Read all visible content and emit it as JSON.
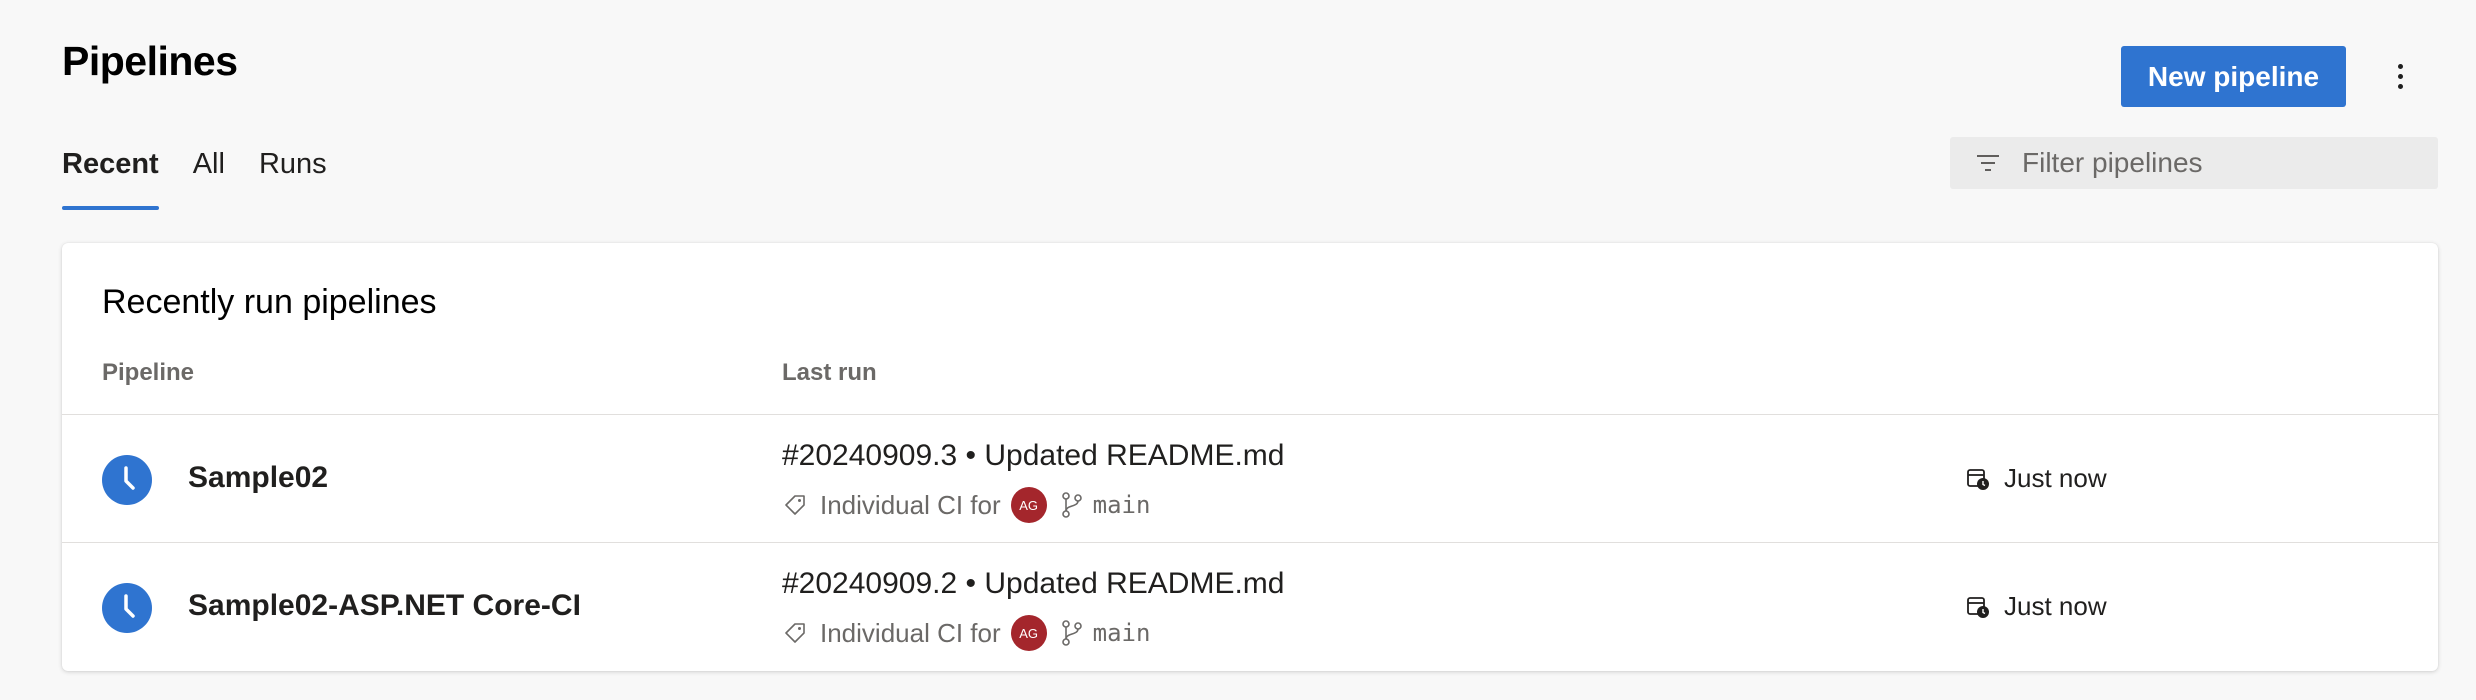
{
  "header": {
    "title": "Pipelines",
    "new_button_label": "New pipeline",
    "more_icon": "more-vertical-icon"
  },
  "tabs": [
    {
      "label": "Recent",
      "active": true
    },
    {
      "label": "All",
      "active": false
    },
    {
      "label": "Runs",
      "active": false
    }
  ],
  "filter": {
    "placeholder": "Filter pipelines",
    "value": "",
    "icon": "filter-icon"
  },
  "card": {
    "title": "Recently run pipelines",
    "columns": [
      "Pipeline",
      "Last run"
    ]
  },
  "rows": [
    {
      "name": "Sample02",
      "status_icon": "in-progress-clock-icon",
      "run_title": "#20240909.3 • Updated README.md",
      "trigger": "Individual CI for",
      "avatar_initials": "AG",
      "branch": "main",
      "when": "Just now"
    },
    {
      "name": "Sample02-ASP.NET Core-CI",
      "status_icon": "in-progress-clock-icon",
      "run_title": "#20240909.2 • Updated README.md",
      "trigger": "Individual CI for",
      "avatar_initials": "AG",
      "branch": "main",
      "when": "Just now"
    }
  ],
  "colors": {
    "accent": "#2f74d0",
    "avatar": "#a4262c",
    "background": "#f8f8f8"
  }
}
